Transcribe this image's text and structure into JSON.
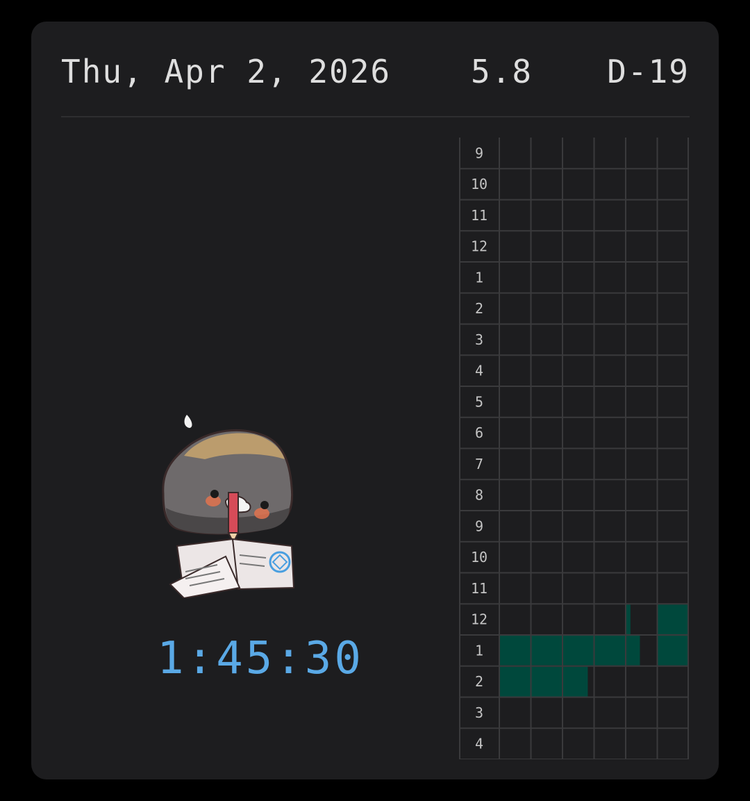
{
  "header": {
    "date": "Thu, Apr 2, 2026",
    "score": "5.8",
    "dday": "D-19"
  },
  "timer": {
    "elapsed": "1:45:30"
  },
  "mascot": {
    "icon": "studying-rock-character-icon"
  },
  "colors": {
    "background": "#1d1d1f",
    "grid_line": "#3a3a3c",
    "filled": "#00483c",
    "timer": "#5aa9e6"
  },
  "study_grid": {
    "columns_per_hour": 6,
    "rows": [
      {
        "label": "9",
        "filled": [
          0,
          0,
          0,
          0,
          0,
          0
        ]
      },
      {
        "label": "10",
        "filled": [
          0,
          0,
          0,
          0,
          0,
          0
        ]
      },
      {
        "label": "11",
        "filled": [
          0,
          0,
          0,
          0,
          0,
          0
        ]
      },
      {
        "label": "12",
        "filled": [
          0,
          0,
          0,
          0,
          0,
          0
        ]
      },
      {
        "label": "1",
        "filled": [
          0,
          0,
          0,
          0,
          0,
          0
        ]
      },
      {
        "label": "2",
        "filled": [
          0,
          0,
          0,
          0,
          0,
          0
        ]
      },
      {
        "label": "3",
        "filled": [
          0,
          0,
          0,
          0,
          0,
          0
        ]
      },
      {
        "label": "4",
        "filled": [
          0,
          0,
          0,
          0,
          0,
          0
        ]
      },
      {
        "label": "5",
        "filled": [
          0,
          0,
          0,
          0,
          0,
          0
        ]
      },
      {
        "label": "6",
        "filled": [
          0,
          0,
          0,
          0,
          0,
          0
        ]
      },
      {
        "label": "7",
        "filled": [
          0,
          0,
          0,
          0,
          0,
          0
        ]
      },
      {
        "label": "8",
        "filled": [
          0,
          0,
          0,
          0,
          0,
          0
        ]
      },
      {
        "label": "9",
        "filled": [
          0,
          0,
          0,
          0,
          0,
          0
        ]
      },
      {
        "label": "10",
        "filled": [
          0,
          0,
          0,
          0,
          0,
          0
        ]
      },
      {
        "label": "11",
        "filled": [
          0,
          0,
          0,
          0,
          0,
          0
        ]
      },
      {
        "label": "12",
        "filled": [
          0,
          0,
          0,
          0,
          0.15,
          1
        ]
      },
      {
        "label": "1",
        "filled": [
          1,
          1,
          1,
          1,
          0.45,
          1
        ]
      },
      {
        "label": "2",
        "filled": [
          1,
          1,
          0.8,
          0,
          0,
          0
        ]
      },
      {
        "label": "3",
        "filled": [
          0,
          0,
          0,
          0,
          0,
          0
        ]
      },
      {
        "label": "4",
        "filled": [
          0,
          0,
          0,
          0,
          0,
          0
        ]
      }
    ]
  }
}
